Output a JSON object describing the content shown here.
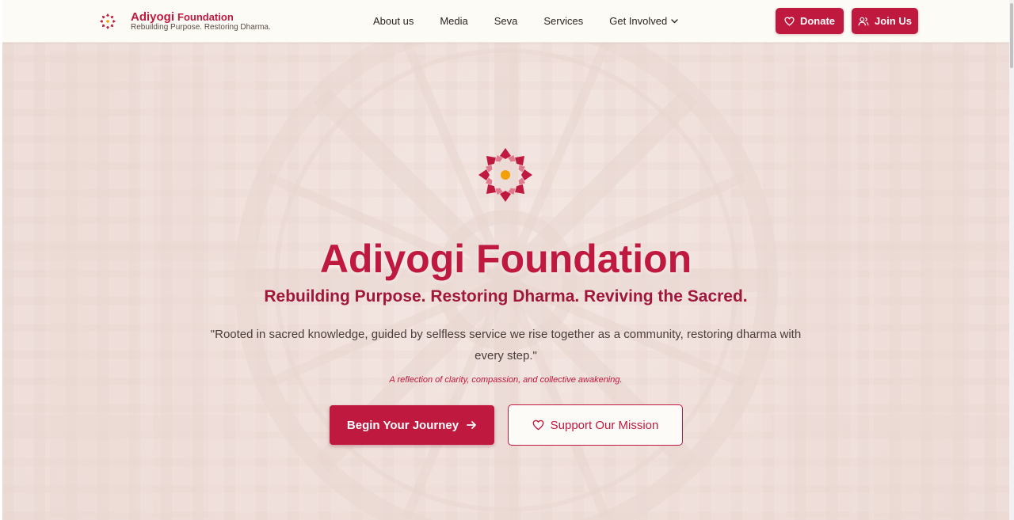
{
  "header": {
    "brand_name": "Adiyogi",
    "brand_suffix": "Foundation",
    "brand_tagline": "Rebuilding Purpose. Restoring Dharma.",
    "brand_icon": "mandala-icon",
    "nav": [
      {
        "label": "About us"
      },
      {
        "label": "Media"
      },
      {
        "label": "Seva"
      },
      {
        "label": "Services"
      },
      {
        "label": "Get Involved",
        "icon": "chevron-down-icon"
      }
    ],
    "donate_label": "Donate",
    "donate_icon": "heart-icon",
    "join_label": "Join Us",
    "join_icon": "users-icon"
  },
  "hero": {
    "emblem_icon": "mandala-icon",
    "title": "Adiyogi Foundation",
    "subtitle": "Rebuilding Purpose. Restoring Dharma. Reviving the Sacred.",
    "quote": "\"Rooted in sacred knowledge, guided by selfless service we rise together as a community, restoring dharma with every step.\"",
    "note": "A reflection of clarity, compassion, and collective awakening.",
    "primary_button": "Begin Your Journey",
    "primary_icon": "arrow-right-icon",
    "secondary_button": "Support Our Mission",
    "secondary_icon": "heart-icon"
  },
  "colors": {
    "accent": "#c0193f",
    "emblem_center": "#f2a007",
    "header_bg": "#fdfbf5"
  }
}
